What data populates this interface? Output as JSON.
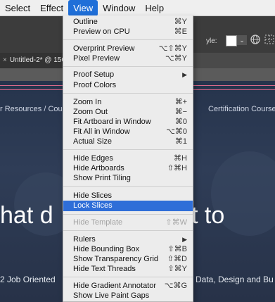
{
  "menubar": {
    "items": [
      "Select",
      "Effect",
      "View",
      "Window",
      "Help"
    ],
    "active": "View"
  },
  "toolbar": {
    "style_label": "yle:",
    "dropdown_arrow": "⌄",
    "icons": [
      "globe-icon",
      "grid-icon"
    ]
  },
  "document_tab": {
    "close_glyph": "×",
    "title": "Untitled-2* @ 15C"
  },
  "artboard": {
    "nav_left": "r Resources / Cour",
    "nav_right": "Certification Courses",
    "hero_left": "hat d",
    "hero_right": "t to",
    "sub_left": "2 Job Oriented",
    "sub_right": "Data, Design and Bu"
  },
  "view_menu": {
    "items": [
      {
        "label": "Outline",
        "shortcut": "⌘Y"
      },
      {
        "label": "Preview on CPU",
        "shortcut": "⌘E"
      },
      {
        "label": "Overprint Preview",
        "shortcut": "⌥⇧⌘Y"
      },
      {
        "label": "Pixel Preview",
        "shortcut": "⌥⌘Y"
      },
      {
        "label": "Proof Setup",
        "shortcut": ""
      },
      {
        "label": "Proof Colors",
        "shortcut": ""
      },
      {
        "label": "Zoom In",
        "shortcut": "⌘+"
      },
      {
        "label": "Zoom Out",
        "shortcut": "⌘−"
      },
      {
        "label": "Fit Artboard in Window",
        "shortcut": "⌘0"
      },
      {
        "label": "Fit All in Window",
        "shortcut": "⌥⌘0"
      },
      {
        "label": "Actual Size",
        "shortcut": "⌘1"
      },
      {
        "label": "Hide Edges",
        "shortcut": "⌘H"
      },
      {
        "label": "Hide Artboards",
        "shortcut": "⇧⌘H"
      },
      {
        "label": "Show Print Tiling",
        "shortcut": ""
      },
      {
        "label": "Hide Slices",
        "shortcut": ""
      },
      {
        "label": "Lock Slices",
        "shortcut": ""
      },
      {
        "label": "Hide Template",
        "shortcut": "⇧⌘W"
      },
      {
        "label": "Rulers",
        "shortcut": ""
      },
      {
        "label": "Hide Bounding Box",
        "shortcut": "⇧⌘B"
      },
      {
        "label": "Show Transparency Grid",
        "shortcut": "⇧⌘D"
      },
      {
        "label": "Hide Text Threads",
        "shortcut": "⇧⌘Y"
      },
      {
        "label": "Hide Gradient Annotator",
        "shortcut": "⌥⌘G"
      },
      {
        "label": "Show Live Paint Gaps",
        "shortcut": ""
      }
    ],
    "submenu_arrow": "▶",
    "highlighted_item": "Lock Slices",
    "disabled_item": "Hide Template",
    "highlight_color": "#2f6ed8"
  }
}
